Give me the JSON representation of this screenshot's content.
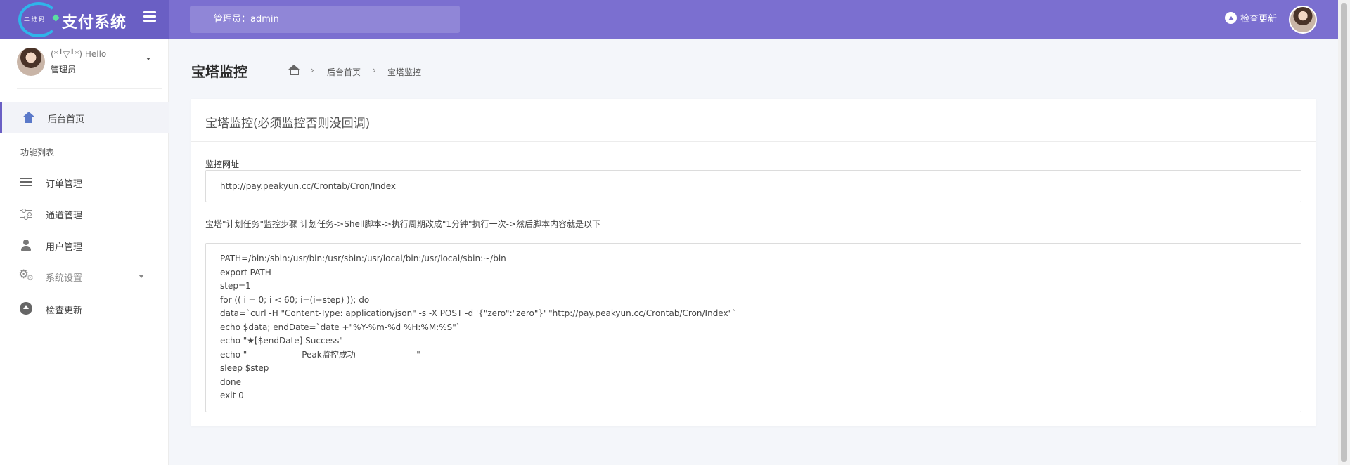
{
  "logo": {
    "small_text": "二 维 码",
    "main_text": "支付系统"
  },
  "header": {
    "admin_label": "管理员：admin",
    "update_label": "检查更新"
  },
  "sidebar": {
    "profile_name": "(*╹▽╹*) Hello",
    "profile_role": "管理员",
    "home_label": "后台首页",
    "section_label": "功能列表",
    "items": [
      {
        "label": "订单管理",
        "icon": "list-icon"
      },
      {
        "label": "通道管理",
        "icon": "sliders-icon"
      },
      {
        "label": "用户管理",
        "icon": "user-icon"
      },
      {
        "label": "系统设置",
        "icon": "gear-icon"
      },
      {
        "label": "检查更新",
        "icon": "upload-icon"
      }
    ]
  },
  "page": {
    "title": "宝塔监控",
    "breadcrumb": {
      "home": "后台首页",
      "current": "宝塔监控"
    }
  },
  "panel": {
    "title": "宝塔监控(必须监控否则没回调)",
    "field_label": "监控网址",
    "url_value": "http://pay.peakyun.cc/Crontab/Cron/Index",
    "instruction": "宝塔\"计划任务\"监控步骤 计划任务->Shell脚本->执行周期改成\"1分钟\"执行一次->然后脚本内容就是以下",
    "script": "PATH=/bin:/sbin:/usr/bin:/usr/sbin:/usr/local/bin:/usr/local/sbin:~/bin\nexport PATH\nstep=1\nfor (( i = 0; i < 60; i=(i+step) )); do\ndata=`curl -H \"Content-Type: application/json\" -s -X POST -d '{\"zero\":\"zero\"}' \"http://pay.peakyun.cc/Crontab/Cron/Index\"`\necho $data; endDate=`date +\"%Y-%m-%d %H:%M:%S\"`\necho \"★[$endDate] Success\"\necho \"------------------Peak监控成功--------------------\"\nsleep $step\ndone\nexit 0"
  },
  "colors": {
    "topbar": "#7b6fd0",
    "logo_bg": "#6a5fc4",
    "accent": "#5b79c9"
  }
}
